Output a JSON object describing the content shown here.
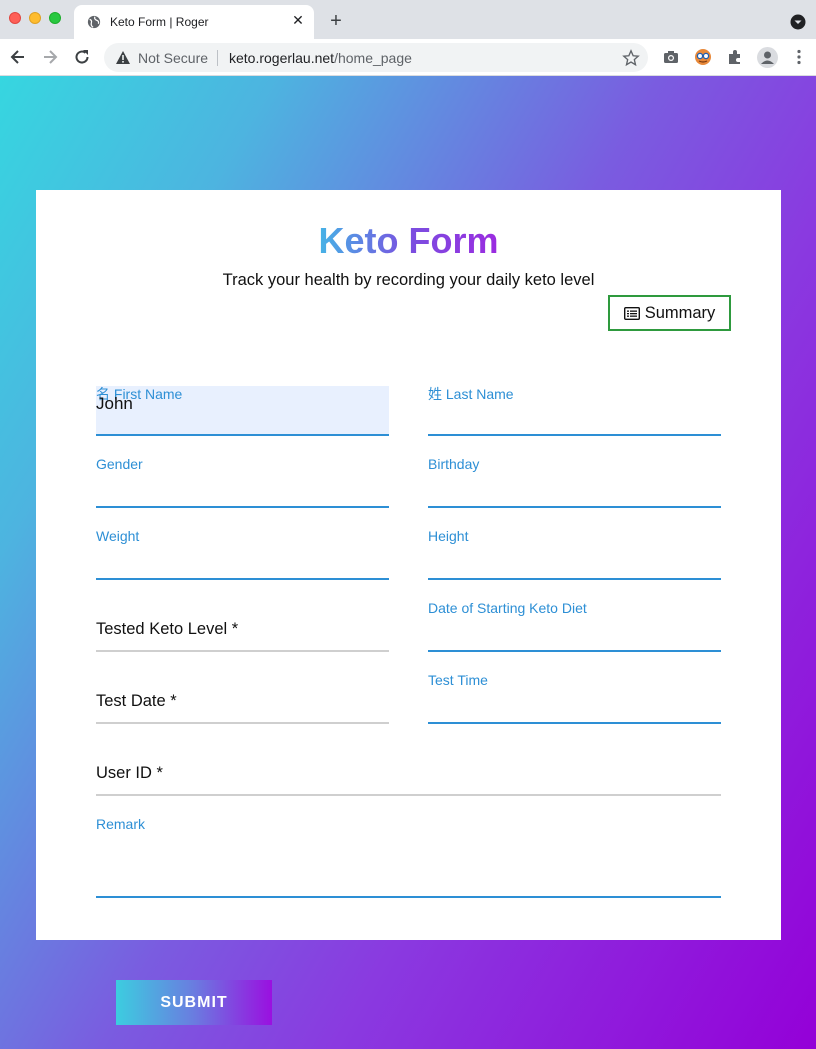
{
  "browser": {
    "tab_title": "Keto Form | Roger",
    "tab_close": "✕",
    "new_tab": "+",
    "security_label": "Not Secure",
    "url_host": "keto.rogerlau.net",
    "url_path": "/home_page"
  },
  "form": {
    "title": "Keto Form",
    "subtitle": "Track your health by recording your daily keto level",
    "summary_label": "Summary",
    "fields": {
      "first_name": {
        "label": "名 First Name",
        "value": "John"
      },
      "last_name": {
        "label": "姓 Last Name",
        "value": ""
      },
      "gender": {
        "label": "Gender"
      },
      "birthday": {
        "label": "Birthday"
      },
      "weight": {
        "label": "Weight"
      },
      "height": {
        "label": "Height"
      },
      "tested_keto_level": {
        "label": "Tested Keto Level *"
      },
      "date_starting": {
        "label": "Date of Starting Keto Diet"
      },
      "test_date": {
        "label": "Test Date *"
      },
      "test_time": {
        "label": "Test Time"
      },
      "user_id": {
        "label": "User ID *"
      },
      "remark": {
        "label": "Remark"
      }
    },
    "submit_label": "SUBMIT"
  },
  "icons": {
    "tab_favicon": "globe-icon",
    "warning": "warning-icon",
    "bookmark": "star-icon",
    "camera": "camera-icon",
    "extension": "puzzle-icon",
    "profile": "profile-icon",
    "menu": "kebab-menu-icon",
    "summary": "list-icon"
  },
  "colors": {
    "accent_blue": "#2d8fd5",
    "summary_border": "#2e9a3e",
    "gradient_start": "#36d6e0",
    "gradient_end": "#9400d8"
  }
}
